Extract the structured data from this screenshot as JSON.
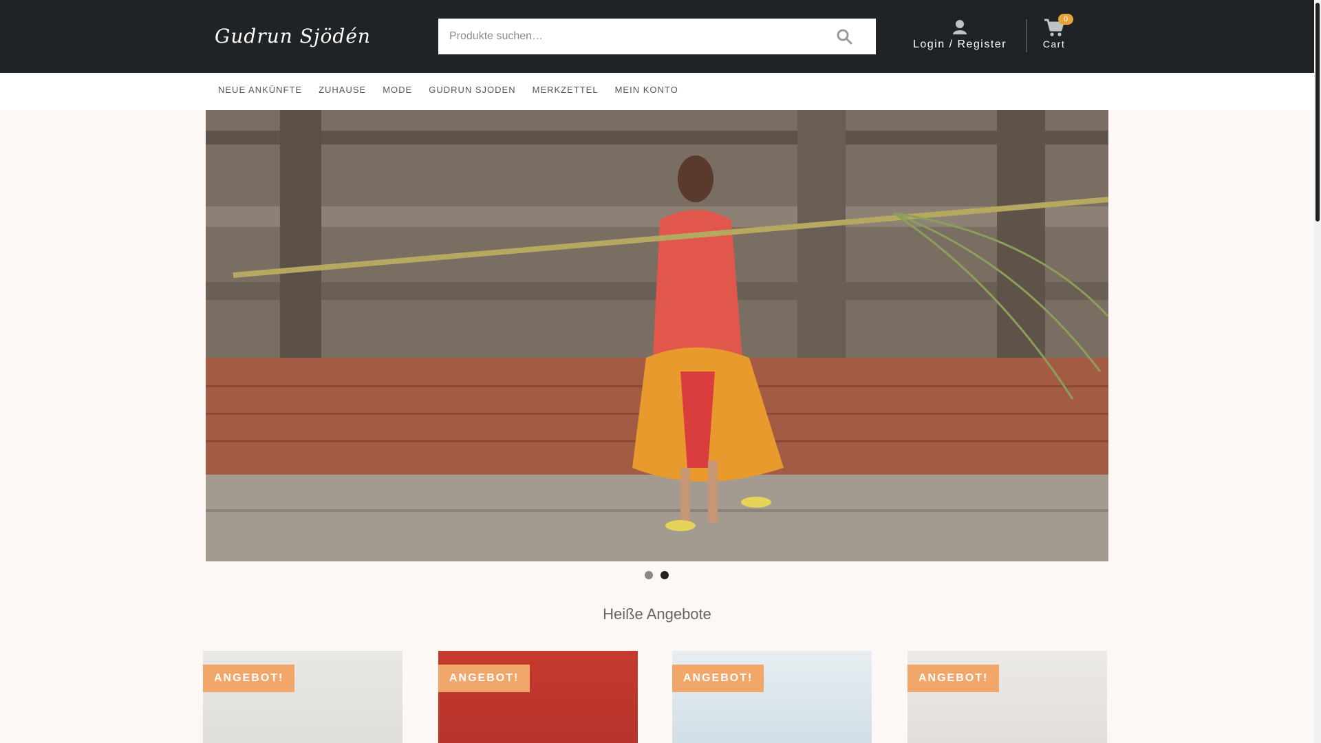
{
  "header": {
    "logo_text": "Gudrun Sjödén",
    "search_placeholder": "Produkte suchen…",
    "login_label": "Login / Register",
    "cart_label": "Cart",
    "cart_count": "0"
  },
  "nav": {
    "items": [
      "NEUE ANKÜNFTE",
      "ZUHAUSE",
      "MODE",
      "GUDRUN SJODEN",
      "MERKZETTEL",
      "MEIN KONTO"
    ]
  },
  "slider": {
    "slide_count": 2,
    "active_slide": 2
  },
  "section": {
    "title": "Heiße Angebote"
  },
  "products": [
    {
      "badge": "ANGEBOT!"
    },
    {
      "badge": "ANGEBOT!"
    },
    {
      "badge": "ANGEBOT!"
    },
    {
      "badge": "ANGEBOT!"
    }
  ],
  "colors": {
    "header_bg": "#1f2326",
    "badge_sale": "#f2a76a",
    "cart_badge": "#e8a23c",
    "page_bg": "#fdf8f5"
  }
}
